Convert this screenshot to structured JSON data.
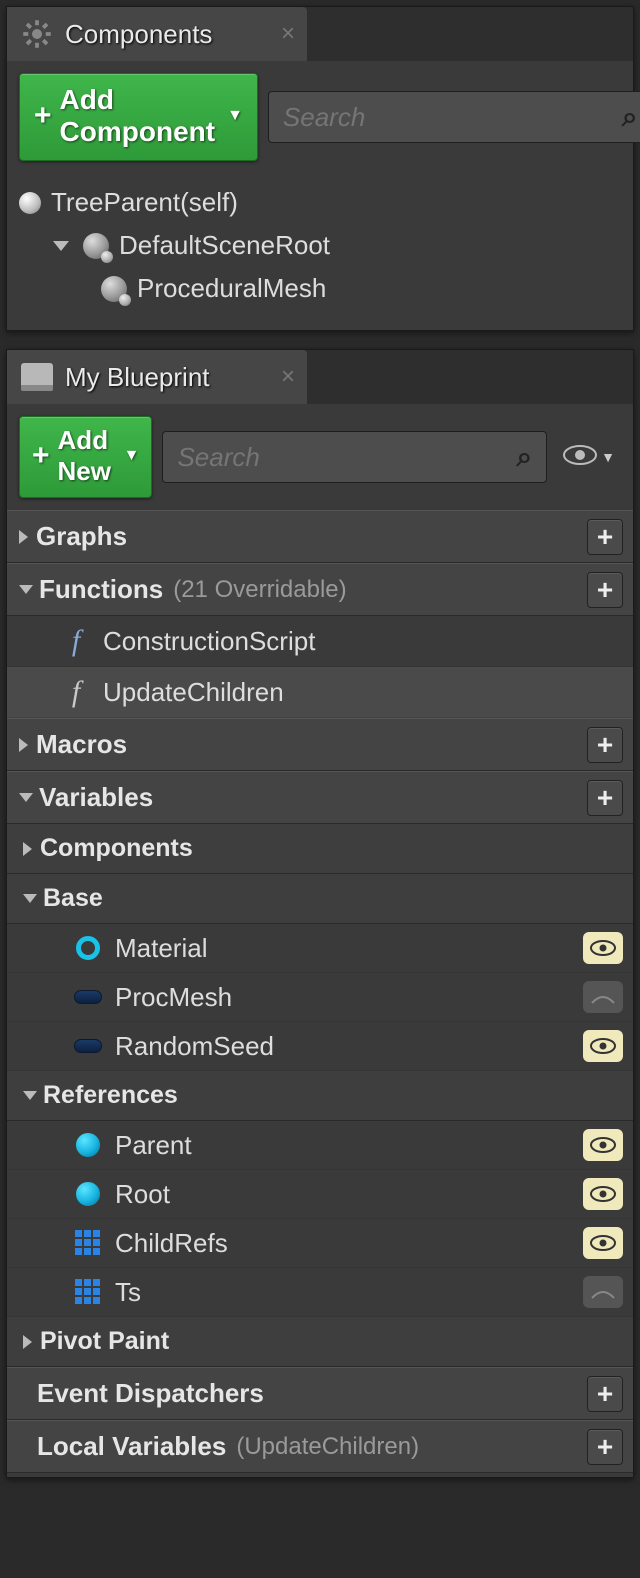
{
  "components_panel": {
    "title": "Components",
    "add_button": "Add Component",
    "search_placeholder": "Search",
    "tree": {
      "root": "TreeParent(self)",
      "scene_root": "DefaultSceneRoot",
      "proc_mesh": "ProceduralMesh"
    }
  },
  "blueprint_panel": {
    "title": "My Blueprint",
    "add_button": "Add New",
    "search_placeholder": "Search",
    "sections": {
      "graphs": {
        "label": "Graphs"
      },
      "functions": {
        "label": "Functions",
        "note": "(21 Overridable)",
        "items": {
          "construction": "ConstructionScript",
          "update_children": "UpdateChildren"
        }
      },
      "macros": {
        "label": "Macros"
      },
      "variables": {
        "label": "Variables",
        "groups": {
          "components": "Components",
          "base": {
            "label": "Base",
            "items": {
              "material": "Material",
              "procmesh": "ProcMesh",
              "randomseed": "RandomSeed"
            }
          },
          "references": {
            "label": "References",
            "items": {
              "parent": "Parent",
              "root": "Root",
              "childrefs": "ChildRefs",
              "ts": "Ts"
            }
          },
          "pivot_paint": "Pivot Paint"
        }
      },
      "event_dispatchers": {
        "label": "Event Dispatchers"
      },
      "local_variables": {
        "label": "Local Variables",
        "note": "(UpdateChildren)"
      }
    }
  }
}
